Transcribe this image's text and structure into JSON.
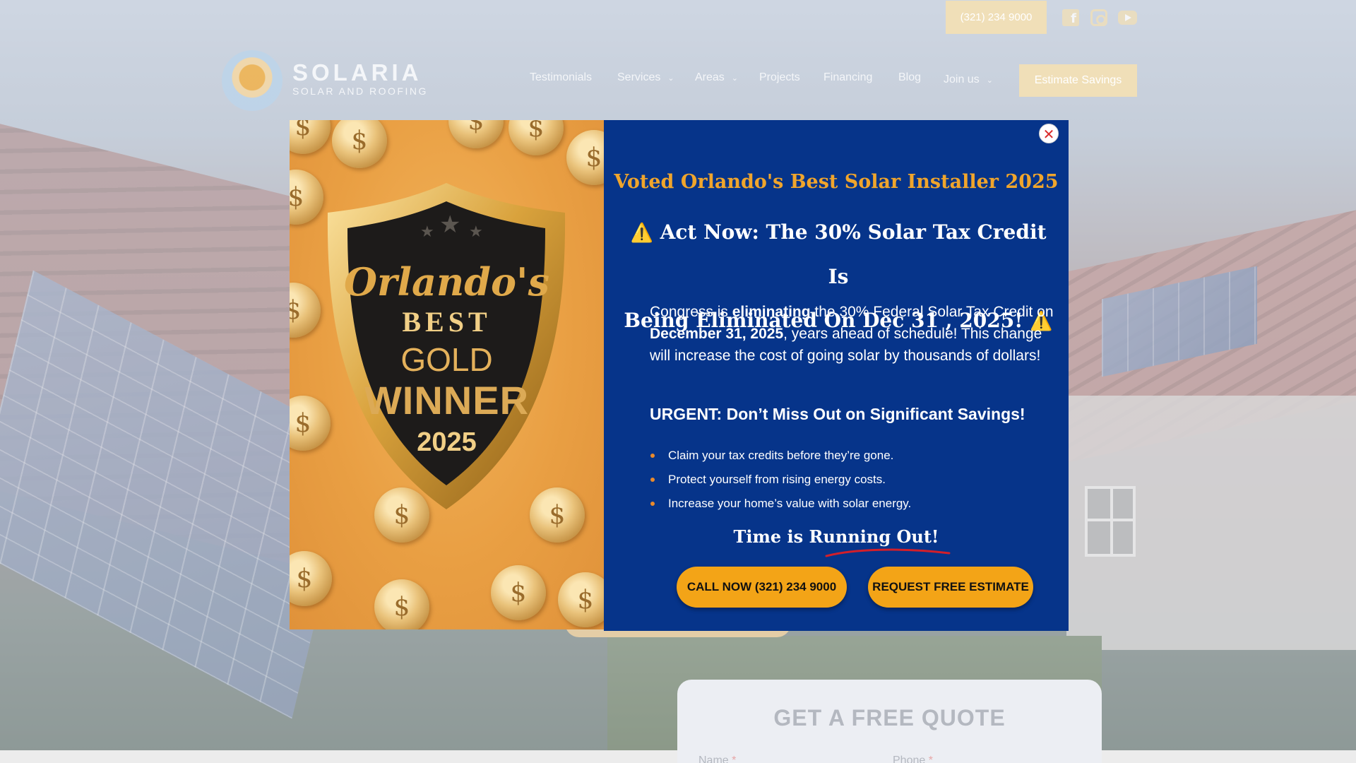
{
  "topbar": {
    "phone": "(321) 234 9000",
    "social_icons": [
      "facebook-icon",
      "instagram-icon",
      "youtube-icon"
    ]
  },
  "header": {
    "logo_title": "SOLARIA",
    "logo_subtitle": "SOLAR AND ROOFING",
    "nav": [
      {
        "label": "Testimonials",
        "dropdown": false
      },
      {
        "label": "Services",
        "dropdown": true
      },
      {
        "label": "Areas",
        "dropdown": true
      },
      {
        "label": "Projects",
        "dropdown": false
      },
      {
        "label": "Financing",
        "dropdown": false
      },
      {
        "label": "Blog",
        "dropdown": false
      },
      {
        "label": "Join us",
        "dropdown": true
      }
    ],
    "cta": "Estimate Savings"
  },
  "quote_form": {
    "title": "GET A FREE QUOTE",
    "name_label": "Name",
    "phone_label": "Phone",
    "required_mark": "*"
  },
  "modal": {
    "badge": {
      "line1": "Orlando's",
      "line2": "BEST",
      "line3": "GOLD",
      "line4": "WINNER",
      "line5": "2025"
    },
    "voted": "Voted Orlando's Best Solar Installer 2025",
    "headline_line1": "Act Now: The 30% Solar Tax Credit Is",
    "headline_line2": "Being Eliminated On Dec 31 , 2025!",
    "warning_glyph": "⚠️",
    "paragraph": {
      "p1": "Congress is ",
      "b1": "eliminating",
      "p2": " the 30% Federal Solar Tax Credit on ",
      "b2": "December 31, 2025",
      "p3": ", years ahead of schedule! This change will increase the cost of going solar by thousands of dollars!"
    },
    "urgent": "URGENT:  Don’t Miss Out on Significant Savings!",
    "bullets": [
      "Claim your tax credits before they’re gone.",
      "Protect yourself from rising energy costs.",
      "Increase your home’s value with solar energy."
    ],
    "running_out": "Time is Running Out!",
    "call_button": "CALL NOW (321) 234 9000",
    "estimate_button": "REQUEST FREE ESTIMATE",
    "close_glyph": "✕"
  },
  "colors": {
    "modal_bg": "#06348a",
    "accent_orange": "#f3a417",
    "headline_gold": "#f0a52c",
    "bullet_dot": "#e98a2c"
  }
}
